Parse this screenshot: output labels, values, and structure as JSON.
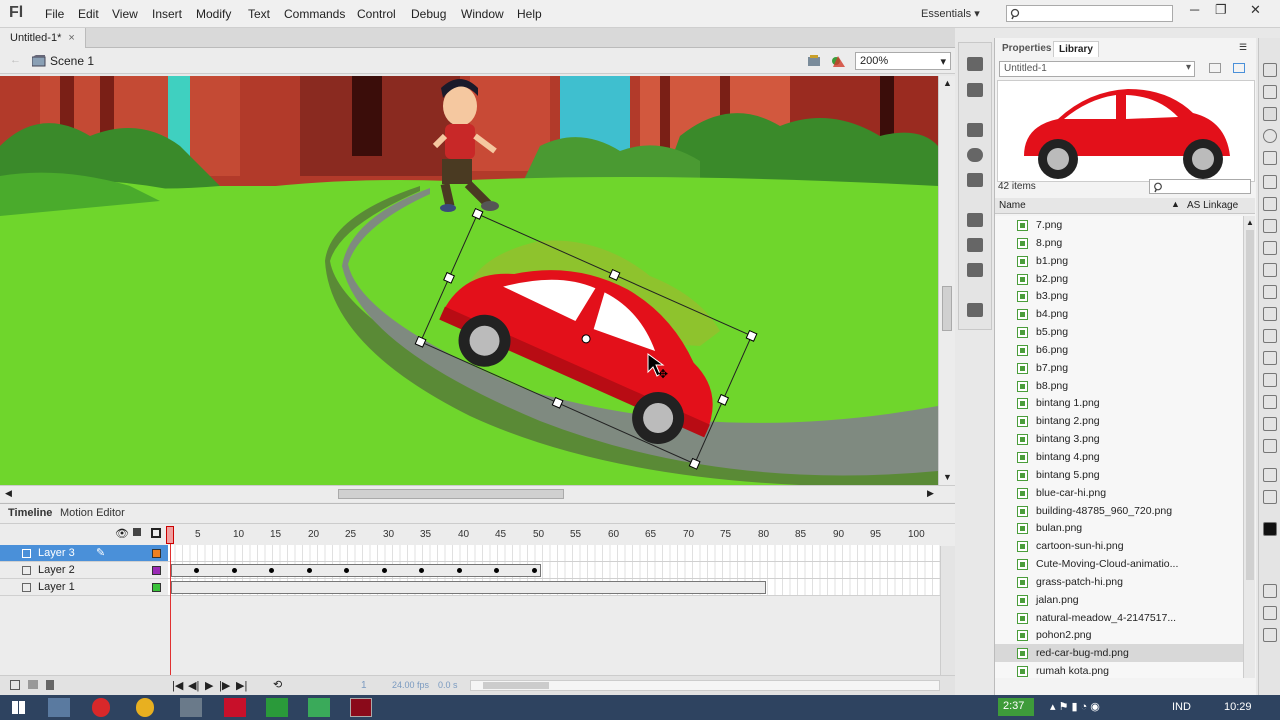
{
  "app": {
    "logo": "Fl"
  },
  "menu": [
    "File",
    "Edit",
    "View",
    "Insert",
    "Modify",
    "Text",
    "Commands",
    "Control",
    "Debug",
    "Window",
    "Help"
  ],
  "workspace": {
    "label": "Essentials",
    "chevron": "▾"
  },
  "window_controls": {
    "minimize": "─",
    "restore": "❐",
    "close": "✕"
  },
  "document": {
    "tab_label": "Untitled-1*",
    "tab_close": "×",
    "scene": "Scene 1",
    "zoom": "200%"
  },
  "timeline": {
    "tabs": [
      "Timeline",
      "Motion Editor"
    ],
    "ruler": [
      "5",
      "10",
      "15",
      "20",
      "25",
      "30",
      "35",
      "40",
      "45",
      "50",
      "55",
      "60",
      "65",
      "70",
      "75",
      "80",
      "85",
      "90",
      "95",
      "100"
    ],
    "layers": [
      "Layer 3",
      "Layer 2",
      "Layer 1"
    ],
    "current_frame": "1",
    "fps": "24.00 fps",
    "time": "0.0 s"
  },
  "panel": {
    "tabs": [
      "Properties",
      "Library"
    ],
    "library_doc": "Untitled-1",
    "items_count": "42 items",
    "col_name": "Name",
    "col_linkage": "AS Linkage",
    "items": [
      "7.png",
      "8.png",
      "b1.png",
      "b2.png",
      "b3.png",
      "b4.png",
      "b5.png",
      "b6.png",
      "b7.png",
      "b8.png",
      "bintang 1.png",
      "bintang 2.png",
      "bintang 3.png",
      "bintang 4.png",
      "bintang 5.png",
      "blue-car-hi.png",
      "building-48785_960_720.png",
      "bulan.png",
      "cartoon-sun-hi.png",
      "Cute-Moving-Cloud-animatio...",
      "grass-patch-hi.png",
      "jalan.png",
      "natural-meadow_4-2147517...",
      "pohon2.png",
      "red-car-bug-md.png",
      "rumah kota.png"
    ],
    "selected_item": "red-car-bug-md.png"
  },
  "taskbar": {
    "battery": "2:37",
    "lang": "IND",
    "clock": "10:29"
  },
  "colors": {
    "car_red": "#e3101a",
    "grass": "#6fd62c",
    "road": "#7f8a80",
    "taskbar": "#2e4360",
    "selection": "#4a90d9"
  }
}
